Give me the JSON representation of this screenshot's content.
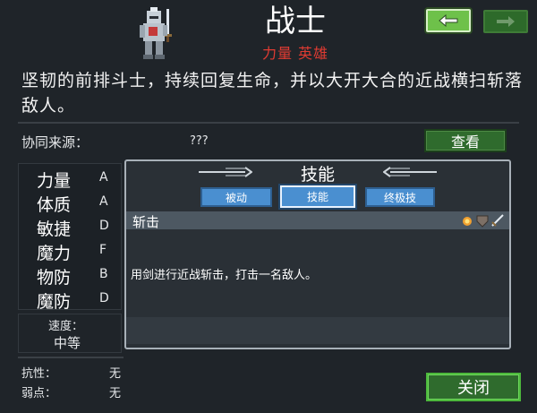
{
  "hero": {
    "name": "战士",
    "tags": [
      "力量",
      "英雄"
    ],
    "description": "坚韧的前排斗士，持续回复生命，并以大开大合的近战横扫斩落敌人。"
  },
  "synergy": {
    "label": "协同来源：",
    "value": "???",
    "view_button": "查看"
  },
  "stats": [
    {
      "name": "力量",
      "grade": "A"
    },
    {
      "name": "体质",
      "grade": "A"
    },
    {
      "name": "敏捷",
      "grade": "D"
    },
    {
      "name": "魔力",
      "grade": "F"
    },
    {
      "name": "物防",
      "grade": "B"
    },
    {
      "name": "魔防",
      "grade": "D"
    }
  ],
  "speed": {
    "label": "速度：",
    "value": "中等"
  },
  "resistance": {
    "label": "抗性：",
    "value": "无"
  },
  "weakness": {
    "label": "弱点：",
    "value": "无"
  },
  "skills": {
    "heading": "技能",
    "tabs": [
      "被动",
      "技能",
      "终极技"
    ],
    "active_tab": "技能",
    "skill_name": "斩击",
    "skill_desc": "用剑进行近战斩击，打击一名敌人。"
  },
  "close_button": "关闭",
  "icons": {
    "back": "arrow-left-icon",
    "forward": "arrow-right-icon",
    "skill_tags": [
      "fire-icon",
      "shield-icon",
      "sword-icon"
    ]
  },
  "colors": {
    "tag_red": "#e03b32",
    "button_green": "#2f6b2d",
    "tab_blue": "#4a8fd0"
  }
}
